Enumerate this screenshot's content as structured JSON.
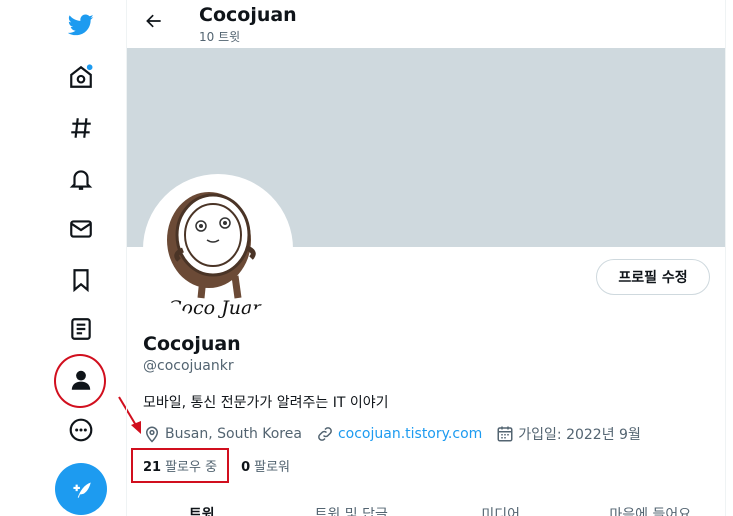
{
  "header": {
    "title": "Cocojuan",
    "subtitle": "10 트윗"
  },
  "profile": {
    "name": "Cocojuan",
    "handle": "@cocojuankr",
    "bio": "모바일, 통신 전문가가 알려주는 IT 이야기",
    "location": "Busan, South Korea",
    "website": "cocojuan.tistory.com",
    "joined": "가입일: 2022년 9월",
    "edit_button": "프로필 수정",
    "avatar_text": "Coco Juan"
  },
  "stats": {
    "following_count": "21",
    "following_label": "팔로우 중",
    "followers_count": "0",
    "followers_label": "팔로워"
  },
  "tabs": [
    {
      "label": "트윗"
    },
    {
      "label": "트윗 및 답글"
    },
    {
      "label": "미디어"
    },
    {
      "label": "마음에 들어요"
    }
  ],
  "colors": {
    "accent": "#1d9bf0",
    "banner": "#cfd9de",
    "annotation": "#d10f1e"
  },
  "sidebar": {
    "icons": [
      "twitter-logo-icon",
      "home-icon",
      "explore-hashtag-icon",
      "notifications-bell-icon",
      "messages-envelope-icon",
      "bookmarks-icon",
      "lists-icon",
      "profile-icon",
      "more-icon"
    ]
  }
}
